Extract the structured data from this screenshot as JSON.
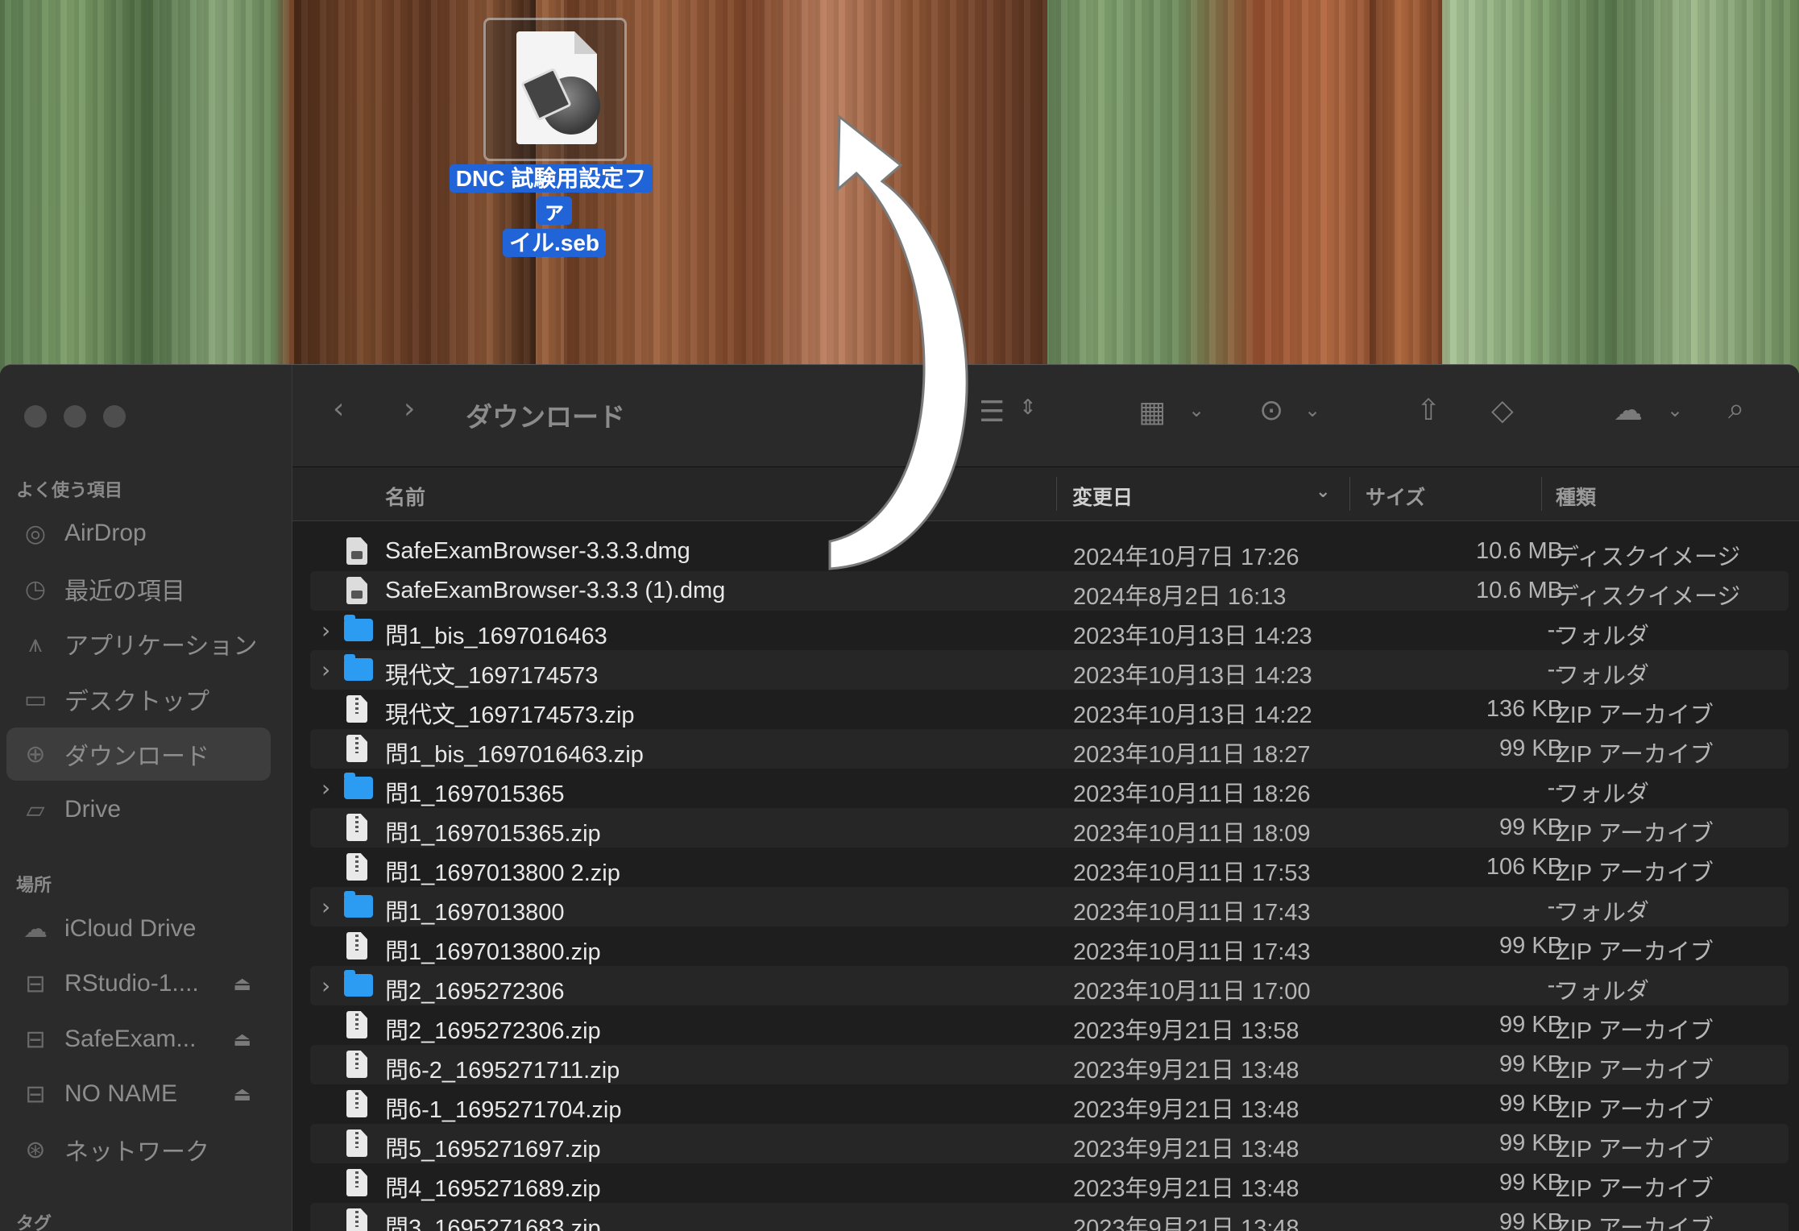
{
  "desktop": {
    "file_label": "DNC 試験用設定ファイル.seb",
    "file_label_line1": "DNC 試験用設定ファ",
    "file_label_line2": "イル.seb",
    "file_icon": "safe-exam-browser-config-icon"
  },
  "annotation": {
    "arrow": "curved-white-arrow"
  },
  "finder": {
    "title": "ダウンロード",
    "toolbar_icons": [
      "back-icon",
      "forward-icon",
      "list-view-icon",
      "grid-view-icon",
      "more-icon",
      "share-icon",
      "tag-icon",
      "icloud-sync-icon",
      "search-icon"
    ],
    "sidebar": {
      "favorites_header": "よく使う項目",
      "favorites": [
        {
          "label": "AirDrop",
          "icon": "airdrop-icon"
        },
        {
          "label": "最近の項目",
          "icon": "clock-icon"
        },
        {
          "label": "アプリケーション",
          "icon": "applications-icon"
        },
        {
          "label": "デスクトップ",
          "icon": "desktop-icon"
        },
        {
          "label": "ダウンロード",
          "icon": "download-icon",
          "selected": true
        },
        {
          "label": "Drive",
          "icon": "folder-icon"
        }
      ],
      "locations_header": "場所",
      "locations": [
        {
          "label": "iCloud Drive",
          "icon": "cloud-icon"
        },
        {
          "label": "RStudio-1....",
          "icon": "disk-icon",
          "eject": true
        },
        {
          "label": "SafeExam...",
          "icon": "disk-icon",
          "eject": true
        },
        {
          "label": "NO NAME",
          "icon": "disk-icon",
          "eject": true
        },
        {
          "label": "ネットワーク",
          "icon": "network-icon"
        }
      ],
      "tags_header": "タグ"
    },
    "columns": {
      "name": "名前",
      "date": "変更日",
      "size": "サイズ",
      "kind": "種類"
    },
    "files": [
      {
        "name": "SafeExamBrowser-3.3.3.dmg",
        "date": "2024年10月7日 17:26",
        "size": "10.6 MB",
        "kind": "ディスクイメージ",
        "type": "dmg"
      },
      {
        "name": "SafeExamBrowser-3.3.3 (1).dmg",
        "date": "2024年8月2日 16:13",
        "size": "10.6 MB",
        "kind": "ディスクイメージ",
        "type": "dmg"
      },
      {
        "name": "問1_bis_1697016463",
        "date": "2023年10月13日 14:23",
        "size": "--",
        "kind": "フォルダ",
        "type": "folder"
      },
      {
        "name": "現代文_1697174573",
        "date": "2023年10月13日 14:23",
        "size": "--",
        "kind": "フォルダ",
        "type": "folder"
      },
      {
        "name": "現代文_1697174573.zip",
        "date": "2023年10月13日 14:22",
        "size": "136 KB",
        "kind": "ZIP アーカイブ",
        "type": "zip"
      },
      {
        "name": "問1_bis_1697016463.zip",
        "date": "2023年10月11日 18:27",
        "size": "99 KB",
        "kind": "ZIP アーカイブ",
        "type": "zip"
      },
      {
        "name": "問1_1697015365",
        "date": "2023年10月11日 18:26",
        "size": "--",
        "kind": "フォルダ",
        "type": "folder"
      },
      {
        "name": "問1_1697015365.zip",
        "date": "2023年10月11日 18:09",
        "size": "99 KB",
        "kind": "ZIP アーカイブ",
        "type": "zip"
      },
      {
        "name": "問1_1697013800 2.zip",
        "date": "2023年10月11日 17:53",
        "size": "106 KB",
        "kind": "ZIP アーカイブ",
        "type": "zip"
      },
      {
        "name": "問1_1697013800",
        "date": "2023年10月11日 17:43",
        "size": "--",
        "kind": "フォルダ",
        "type": "folder"
      },
      {
        "name": "問1_1697013800.zip",
        "date": "2023年10月11日 17:43",
        "size": "99 KB",
        "kind": "ZIP アーカイブ",
        "type": "zip"
      },
      {
        "name": "問2_1695272306",
        "date": "2023年10月11日 17:00",
        "size": "--",
        "kind": "フォルダ",
        "type": "folder"
      },
      {
        "name": "問2_1695272306.zip",
        "date": "2023年9月21日 13:58",
        "size": "99 KB",
        "kind": "ZIP アーカイブ",
        "type": "zip"
      },
      {
        "name": "問6-2_1695271711.zip",
        "date": "2023年9月21日 13:48",
        "size": "99 KB",
        "kind": "ZIP アーカイブ",
        "type": "zip"
      },
      {
        "name": "問6-1_1695271704.zip",
        "date": "2023年9月21日 13:48",
        "size": "99 KB",
        "kind": "ZIP アーカイブ",
        "type": "zip"
      },
      {
        "name": "問5_1695271697.zip",
        "date": "2023年9月21日 13:48",
        "size": "99 KB",
        "kind": "ZIP アーカイブ",
        "type": "zip"
      },
      {
        "name": "問4_1695271689.zip",
        "date": "2023年9月21日 13:48",
        "size": "99 KB",
        "kind": "ZIP アーカイブ",
        "type": "zip"
      },
      {
        "name": "問3_1695271683.zip",
        "date": "2023年9月21日 13:48",
        "size": "99 KB",
        "kind": "ZIP アーカイブ",
        "type": "zip"
      }
    ]
  }
}
